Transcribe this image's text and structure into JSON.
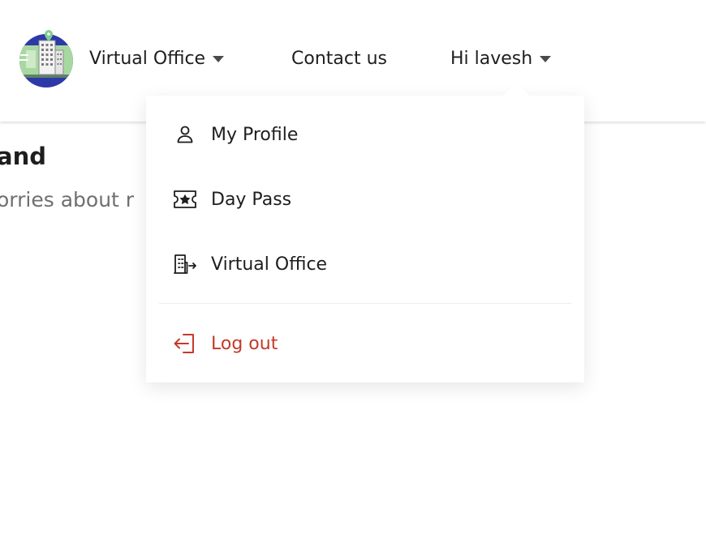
{
  "header": {
    "nav": {
      "virtual_office": "Virtual Office",
      "contact_us": "Contact us",
      "user_greeting": "Hi lavesh"
    }
  },
  "content": {
    "heading": "and",
    "subtext": "orries about r"
  },
  "user_menu": {
    "items": [
      {
        "label": "My Profile",
        "icon": "person-icon"
      },
      {
        "label": "Day Pass",
        "icon": "ticket-star-icon"
      },
      {
        "label": "Virtual Office",
        "icon": "building-arrow-icon"
      },
      {
        "label": "Log out",
        "icon": "logout-icon"
      }
    ]
  },
  "colors": {
    "text": "#1e1e1e",
    "logout": "#c33a2c",
    "subtext": "#6f6f6f",
    "logo_circle": "#2e39a8",
    "logo_green": "#a8d8a2"
  }
}
